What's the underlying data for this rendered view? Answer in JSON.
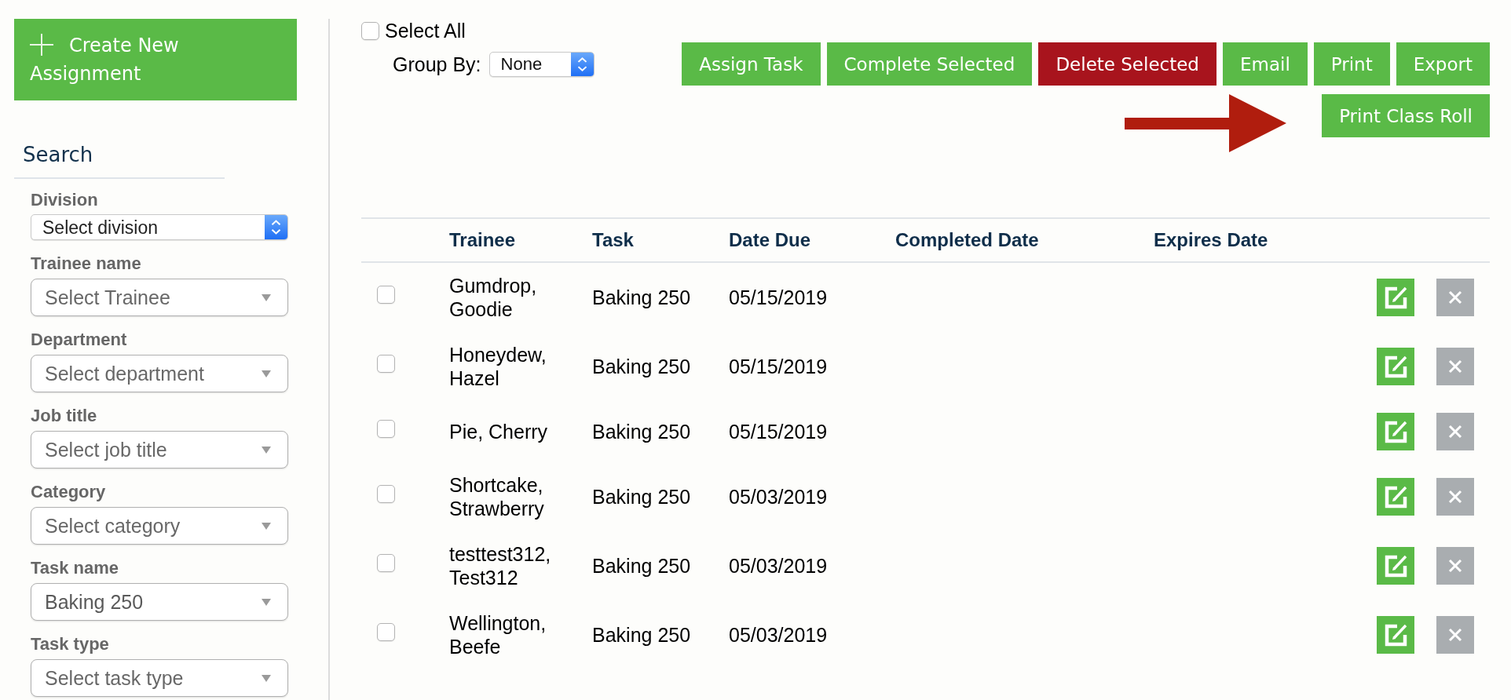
{
  "sidebar": {
    "create_button": {
      "label": "Create New Assignment"
    },
    "search": {
      "title": "Search",
      "filters": [
        {
          "label": "Division",
          "kind": "native",
          "placeholder": "Select division"
        },
        {
          "label": "Trainee name",
          "kind": "dropdown",
          "placeholder": "Select Trainee"
        },
        {
          "label": "Department",
          "kind": "dropdown",
          "placeholder": "Select department"
        },
        {
          "label": "Job title",
          "kind": "dropdown",
          "placeholder": "Select job title"
        },
        {
          "label": "Category",
          "kind": "dropdown",
          "placeholder": "Select category"
        },
        {
          "label": "Task name",
          "kind": "dropdown",
          "value": "Baking 250"
        },
        {
          "label": "Task type",
          "kind": "dropdown",
          "placeholder": "Select task type"
        }
      ]
    }
  },
  "toolbar": {
    "select_all": {
      "label": "Select All",
      "checked": false
    },
    "group_by": {
      "label": "Group By:",
      "value": "None"
    },
    "buttons": [
      {
        "label": "Assign Task",
        "kind": "primary"
      },
      {
        "label": "Complete Selected",
        "kind": "primary"
      },
      {
        "label": "Delete Selected",
        "kind": "danger"
      },
      {
        "label": "Email",
        "kind": "primary"
      },
      {
        "label": "Print",
        "kind": "primary"
      },
      {
        "label": "Export",
        "kind": "primary"
      },
      {
        "label": "Print Class Roll",
        "kind": "primary"
      }
    ]
  },
  "table": {
    "columns": [
      "Trainee",
      "Task",
      "Date Due",
      "Completed Date",
      "Expires Date"
    ],
    "rows": [
      {
        "checked": false,
        "trainee": "Gumdrop, Goodie",
        "task": "Baking 250",
        "date_due": "05/15/2019"
      },
      {
        "checked": false,
        "trainee": "Honeydew, Hazel",
        "task": "Baking 250",
        "date_due": "05/15/2019"
      },
      {
        "checked": false,
        "trainee": "Pie, Cherry",
        "task": "Baking 250",
        "date_due": "05/15/2019"
      },
      {
        "checked": false,
        "trainee": "Shortcake, Strawberry",
        "task": "Baking 250",
        "date_due": "05/03/2019"
      },
      {
        "checked": false,
        "trainee": "testtest312, Test312",
        "task": "Baking 250",
        "date_due": "05/03/2019"
      },
      {
        "checked": false,
        "trainee": "Wellington, Beefe",
        "task": "Baking 250",
        "date_due": "05/03/2019"
      }
    ]
  }
}
